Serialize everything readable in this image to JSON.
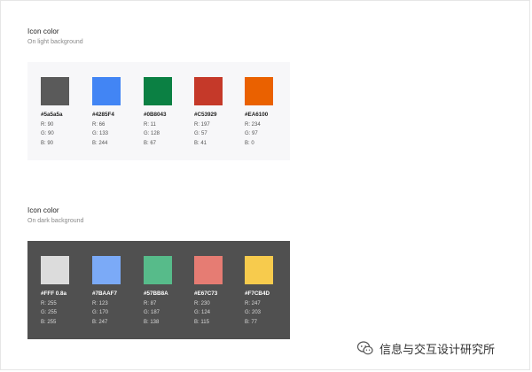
{
  "light_section": {
    "title": "Icon color",
    "subtitle": "On light background",
    "swatches": [
      {
        "hex": "#5a5a5a",
        "label": "#5a5a5a",
        "r": "R: 90",
        "g": "G: 90",
        "b": "B: 90"
      },
      {
        "hex": "#4285F4",
        "label": "#4285F4",
        "r": "R: 66",
        "g": "G: 133",
        "b": "B: 244"
      },
      {
        "hex": "#0B8043",
        "label": "#0B8043",
        "r": "R: 11",
        "g": "G: 128",
        "b": "B: 67"
      },
      {
        "hex": "#C53929",
        "label": "#C53929",
        "r": "R: 197",
        "g": "G: 57",
        "b": "B: 41"
      },
      {
        "hex": "#EA6100",
        "label": "#EA6100",
        "r": "R: 234",
        "g": "G: 97",
        "b": "B: 0"
      }
    ]
  },
  "dark_section": {
    "title": "Icon color",
    "subtitle": "On dark background",
    "swatches": [
      {
        "hex": "#DCDCDC",
        "label": "#FFF 0.8a",
        "r": "R: 255",
        "g": "G: 255",
        "b": "B: 255"
      },
      {
        "hex": "#7BAAF7",
        "label": "#7BAAF7",
        "r": "R: 123",
        "g": "G: 170",
        "b": "B: 247"
      },
      {
        "hex": "#57BB8A",
        "label": "#57BB8A",
        "r": "R: 87",
        "g": "G: 187",
        "b": "B: 138"
      },
      {
        "hex": "#E67C73",
        "label": "#E67C73",
        "r": "R: 230",
        "g": "G: 124",
        "b": "B: 115"
      },
      {
        "hex": "#F7CB4D",
        "label": "#F7CB4D",
        "r": "R: 247",
        "g": "G: 203",
        "b": "B: 77"
      }
    ]
  },
  "watermark": {
    "text": "信息与交互设计研究所",
    "icon": "wechat-icon"
  }
}
